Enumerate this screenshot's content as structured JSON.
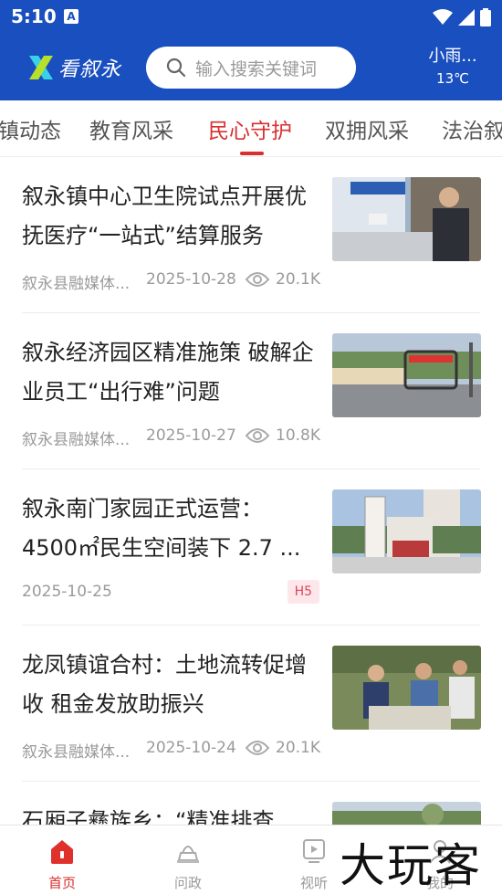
{
  "status_bar": {
    "time": "5:10",
    "notification_letter": "A"
  },
  "header": {
    "logo_text": "看叙永",
    "search_placeholder": "输入搜索关键词",
    "weather_condition": "小雨...",
    "weather_temp": "13℃"
  },
  "tabs": [
    {
      "label": "镇动态",
      "active": false
    },
    {
      "label": "教育风采",
      "active": false
    },
    {
      "label": "民心守护",
      "active": true
    },
    {
      "label": "双拥风采",
      "active": false
    },
    {
      "label": "法治叙",
      "active": false
    }
  ],
  "news": [
    {
      "title": "叙永镇中心卫生院试点开展优抚医疗“一站式”结算服务",
      "source": "叙永县融媒体...",
      "date": "2025-10-28",
      "views": "20.1K",
      "badge": ""
    },
    {
      "title": "叙永经济园区精准施策 破解企业员工“出行难”问题",
      "source": "叙永县融媒体...",
      "date": "2025-10-27",
      "views": "10.8K",
      "badge": ""
    },
    {
      "title": "叙永南门家园正式运营：4500㎡民生空间装下 2.7 ...",
      "source": "",
      "date": "2025-10-25",
      "views": "",
      "badge": "H5"
    },
    {
      "title": "龙凤镇谊合村：土地流转促增收  租金发放助振兴",
      "source": "叙永县融媒体...",
      "date": "2025-10-24",
      "views": "20.1K",
      "badge": ""
    },
    {
      "title": "石厢子彝族乡：“精准排查",
      "source": "",
      "date": "",
      "views": "",
      "badge": ""
    }
  ],
  "bottom_nav": [
    {
      "label": "首页",
      "icon": "home-icon",
      "active": true
    },
    {
      "label": "问政",
      "icon": "inquiry-icon",
      "active": false
    },
    {
      "label": "视听",
      "icon": "video-icon",
      "active": false
    },
    {
      "label": "我的",
      "icon": "profile-icon",
      "active": false
    }
  ],
  "watermark": "大玩客",
  "colors": {
    "brand_blue": "#1a4fbf",
    "active_red": "#d92f2f",
    "badge_bg": "#fde7ea",
    "badge_text": "#e0435a"
  }
}
